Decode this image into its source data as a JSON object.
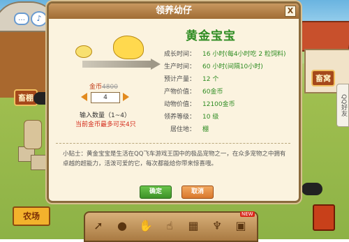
{
  "dialog": {
    "title": "领养幼仔",
    "close_label": "X",
    "pet_name": "黄金宝宝",
    "stats": [
      {
        "label": "成长时间：",
        "value": "16 小时(每4小时吃 2 粒饲料)"
      },
      {
        "label": "生产时间：",
        "value": "60 小时(间隔10小时)"
      },
      {
        "label": "预计产量：",
        "value": "12 个"
      },
      {
        "label": "产物价值：",
        "value": "60金币"
      },
      {
        "label": "动物价值：",
        "value": "12100金币"
      },
      {
        "label": "领养等级：",
        "value": "10 级"
      },
      {
        "label": "居住地：",
        "value": "棚"
      }
    ],
    "price_prefix": "金币",
    "price_value": "4800",
    "quantity": "4",
    "quantity_hint": "输入数量（1~4）",
    "max_hint": "当前金币最多可买4只",
    "tip": "小贴士：黄金宝宝是生活在QQ飞车游戏王国中的极品宠物之一，在众多宠物之中拥有卓越的超能力，活泼可爱的它，每次都能给你带来惊喜哦。",
    "ok_label": "确定",
    "cancel_label": "取消"
  },
  "scene": {
    "left_sign": "畜棚",
    "right_sign": "畜窝",
    "farm_button": "农场",
    "qq_tab": "QQ好友",
    "new_badge": "NEW"
  },
  "toolbar": {
    "tools": [
      "pointer-icon",
      "seed-bag-icon",
      "glove-icon",
      "hand-icon",
      "net-icon",
      "broom-icon",
      "shop-icon"
    ]
  }
}
